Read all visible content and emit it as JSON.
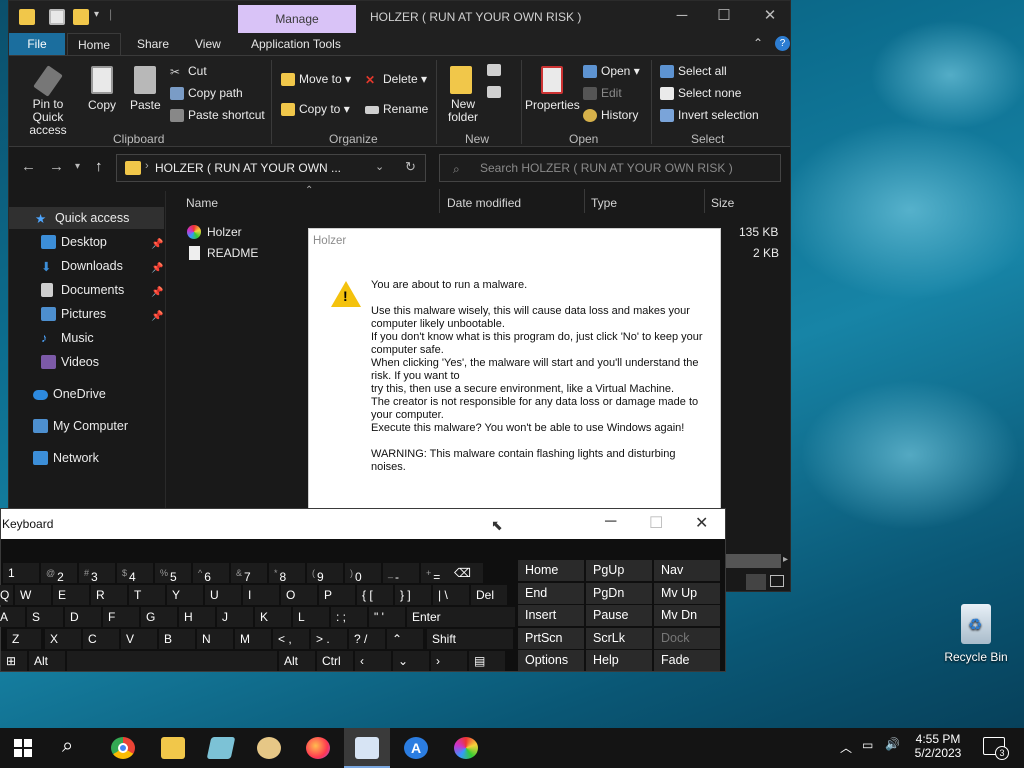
{
  "explorer": {
    "title": "HOLZER ( RUN AT YOUR OWN RISK )",
    "manage_tab": "Manage",
    "tabs": [
      "File",
      "Home",
      "Share",
      "View",
      "Application Tools"
    ],
    "clipboard": {
      "pin": "Pin to Quick access",
      "copy": "Copy",
      "paste": "Paste",
      "cut": "Cut",
      "copy_path": "Copy path",
      "paste_shortcut": "Paste shortcut",
      "group": "Clipboard"
    },
    "organize": {
      "move_to": "Move to",
      "copy_to": "Copy to",
      "delete": "Delete",
      "rename": "Rename",
      "group": "Organize"
    },
    "new": {
      "new_folder": "New folder",
      "group": "New"
    },
    "open": {
      "properties": "Properties",
      "open": "Open",
      "edit": "Edit",
      "history": "History",
      "group": "Open"
    },
    "select": {
      "select_all": "Select all",
      "select_none": "Select none",
      "invert": "Invert selection",
      "group": "Select"
    },
    "address": "HOLZER ( RUN AT YOUR OWN ...",
    "search_placeholder": "Search HOLZER ( RUN AT YOUR OWN RISK )",
    "nav": {
      "quick_access": "Quick access",
      "items": [
        "Desktop",
        "Downloads",
        "Documents",
        "Pictures",
        "Music",
        "Videos"
      ],
      "onedrive": "OneDrive",
      "my_computer": "My Computer",
      "network": "Network"
    },
    "columns": {
      "name": "Name",
      "date": "Date modified",
      "type": "Type",
      "size": "Size"
    },
    "files": [
      {
        "name": "Holzer",
        "size": "135 KB"
      },
      {
        "name": "README",
        "size": "2 KB"
      }
    ]
  },
  "dialog": {
    "title": "Holzer",
    "message": "You are about to run a malware.\n\nUse this malware wisely, this will cause data loss and makes your computer likely unbootable.\nIf you don't know what is this program do, just click 'No' to keep your computer safe.\nWhen clicking 'Yes', the malware will start and you'll understand the risk. If you want to\ntry this, then use a secure environment, like a Virtual Machine.\nThe creator is not responsible for any data loss or damage made to your computer.\nExecute this malware? You won't be able to use Windows again!\n\nWARNING: This malware contain flashing lights and disturbing noises."
  },
  "keyboard": {
    "title": "Keyboard",
    "row1": [
      [
        "",
        "1"
      ],
      [
        "@",
        "2"
      ],
      [
        "#",
        "3"
      ],
      [
        "$",
        "4"
      ],
      [
        "%",
        "5"
      ],
      [
        "^",
        "6"
      ],
      [
        "&",
        "7"
      ],
      [
        "*",
        "8"
      ],
      [
        "(",
        "9"
      ],
      [
        ")",
        "0"
      ],
      [
        "_",
        "-"
      ],
      [
        "+",
        "="
      ]
    ],
    "row2": [
      "W",
      "E",
      "R",
      "T",
      "Y",
      "U",
      "I",
      "O",
      "P"
    ],
    "row2_extra": [
      "{ [",
      "} ]",
      "| \\",
      "Del"
    ],
    "row3": [
      "S",
      "D",
      "F",
      "G",
      "H",
      "J",
      "K",
      "L"
    ],
    "row3_extra": [
      ": ;",
      "\" '",
      "Enter"
    ],
    "row4": [
      "X",
      "C",
      "V",
      "B",
      "N",
      "M"
    ],
    "row4_extra": [
      "< ,",
      "> .",
      "? /"
    ],
    "row4_shift": "Shift",
    "row5": {
      "alt_left": "Alt",
      "alt_right": "Alt",
      "ctrl": "Ctrl"
    },
    "row2_first": "Q",
    "row3_first": "A",
    "row4_first": "Z",
    "nav_keys": [
      [
        "Home",
        "PgUp",
        "Nav"
      ],
      [
        "End",
        "PgDn",
        "Mv Up"
      ],
      [
        "Insert",
        "Pause",
        "Mv Dn"
      ],
      [
        "PrtScn",
        "ScrLk",
        "Dock"
      ],
      [
        "Options",
        "Help",
        "Fade"
      ]
    ]
  },
  "desktop": {
    "recycle_bin": "Recycle Bin"
  },
  "taskbar": {
    "time": "4:55 PM",
    "date": "5/2/2023",
    "notifications": "3"
  }
}
